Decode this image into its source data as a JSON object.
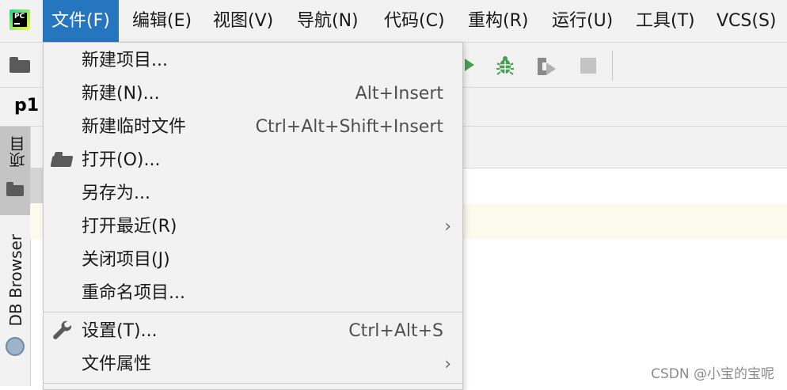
{
  "menubar": {
    "items": [
      {
        "label": "文件(F)",
        "active": true
      },
      {
        "label": "编辑(E)"
      },
      {
        "label": "视图(V)"
      },
      {
        "label": "导航(N)"
      },
      {
        "label": "代码(C)"
      },
      {
        "label": "重构(R)"
      },
      {
        "label": "运行(U)"
      },
      {
        "label": "工具(T)"
      },
      {
        "label": "VCS(S)"
      }
    ],
    "logo_text": "PC",
    "accent_color": "#2675bf"
  },
  "toolbar": {
    "icons": [
      "folder-icon",
      "run-icon",
      "debug-icon",
      "coverage-icon",
      "stop-icon"
    ]
  },
  "tabbar": {
    "label": "p1"
  },
  "left_strip": {
    "project_tab": "项目",
    "db_browser_tab": "DB Browser"
  },
  "file_menu": {
    "items": [
      {
        "label": "新建项目...",
        "shortcut": ""
      },
      {
        "label": "新建(N)...",
        "shortcut": "Alt+Insert"
      },
      {
        "label": "新建临时文件",
        "shortcut": "Ctrl+Alt+Shift+Insert"
      },
      {
        "label": "打开(O)...",
        "shortcut": "",
        "icon": "open-folder-icon"
      },
      {
        "label": "另存为...",
        "shortcut": ""
      },
      {
        "label": "打开最近(R)",
        "shortcut": "",
        "submenu": true
      },
      {
        "label": "关闭项目(J)",
        "shortcut": ""
      },
      {
        "label": "重命名项目...",
        "shortcut": ""
      },
      {
        "label": "设置(T)...",
        "shortcut": "Ctrl+Alt+S",
        "icon": "wrench-icon"
      },
      {
        "label": "文件属性",
        "shortcut": "",
        "submenu": true
      }
    ],
    "submenu_arrow": "›"
  },
  "watermark": "CSDN @小宝的宝呢"
}
